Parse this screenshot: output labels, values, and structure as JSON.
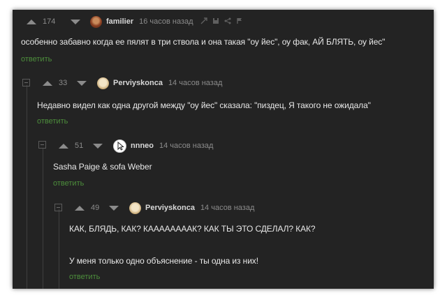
{
  "comments": [
    {
      "rating": "174",
      "author": "familier",
      "time": "16 часов назад",
      "text": "особенно забавно когда ее пялят в три ствола и она такая \"оу йес\", оу фак, АЙ БЛЯТЬ, оу йес\"",
      "reply": "ответить"
    },
    {
      "rating": "33",
      "author": "Perviyskonca",
      "time": "14 часов назад",
      "text": "Недавно видел как одна другой между \"оу йес\" сказала: \"пиздец, Я такого не ожидала\"",
      "reply": "ответить"
    },
    {
      "rating": "51",
      "author": "nnneo",
      "time": "14 часов назад",
      "text": "Sasha Paige & sofa Weber",
      "reply": "ответить"
    },
    {
      "rating": "49",
      "author": "Perviyskonca",
      "time": "14 часов назад",
      "text": "КАК, БЛЯДЬ, КАК? КААААААААК? КАК ТЫ ЭТО СДЕЛАЛ? КАК?",
      "text2": "У меня только одно объяснение - ты одна из них!",
      "reply": "ответить"
    }
  ],
  "tool_icons": [
    "link-icon",
    "save-icon",
    "share-icon",
    "report-flag-icon"
  ],
  "colors": {
    "background": "#232323",
    "text": "#e8e8e8",
    "meta": "#8b8b8b",
    "reply_link": "#4d8f3c"
  }
}
